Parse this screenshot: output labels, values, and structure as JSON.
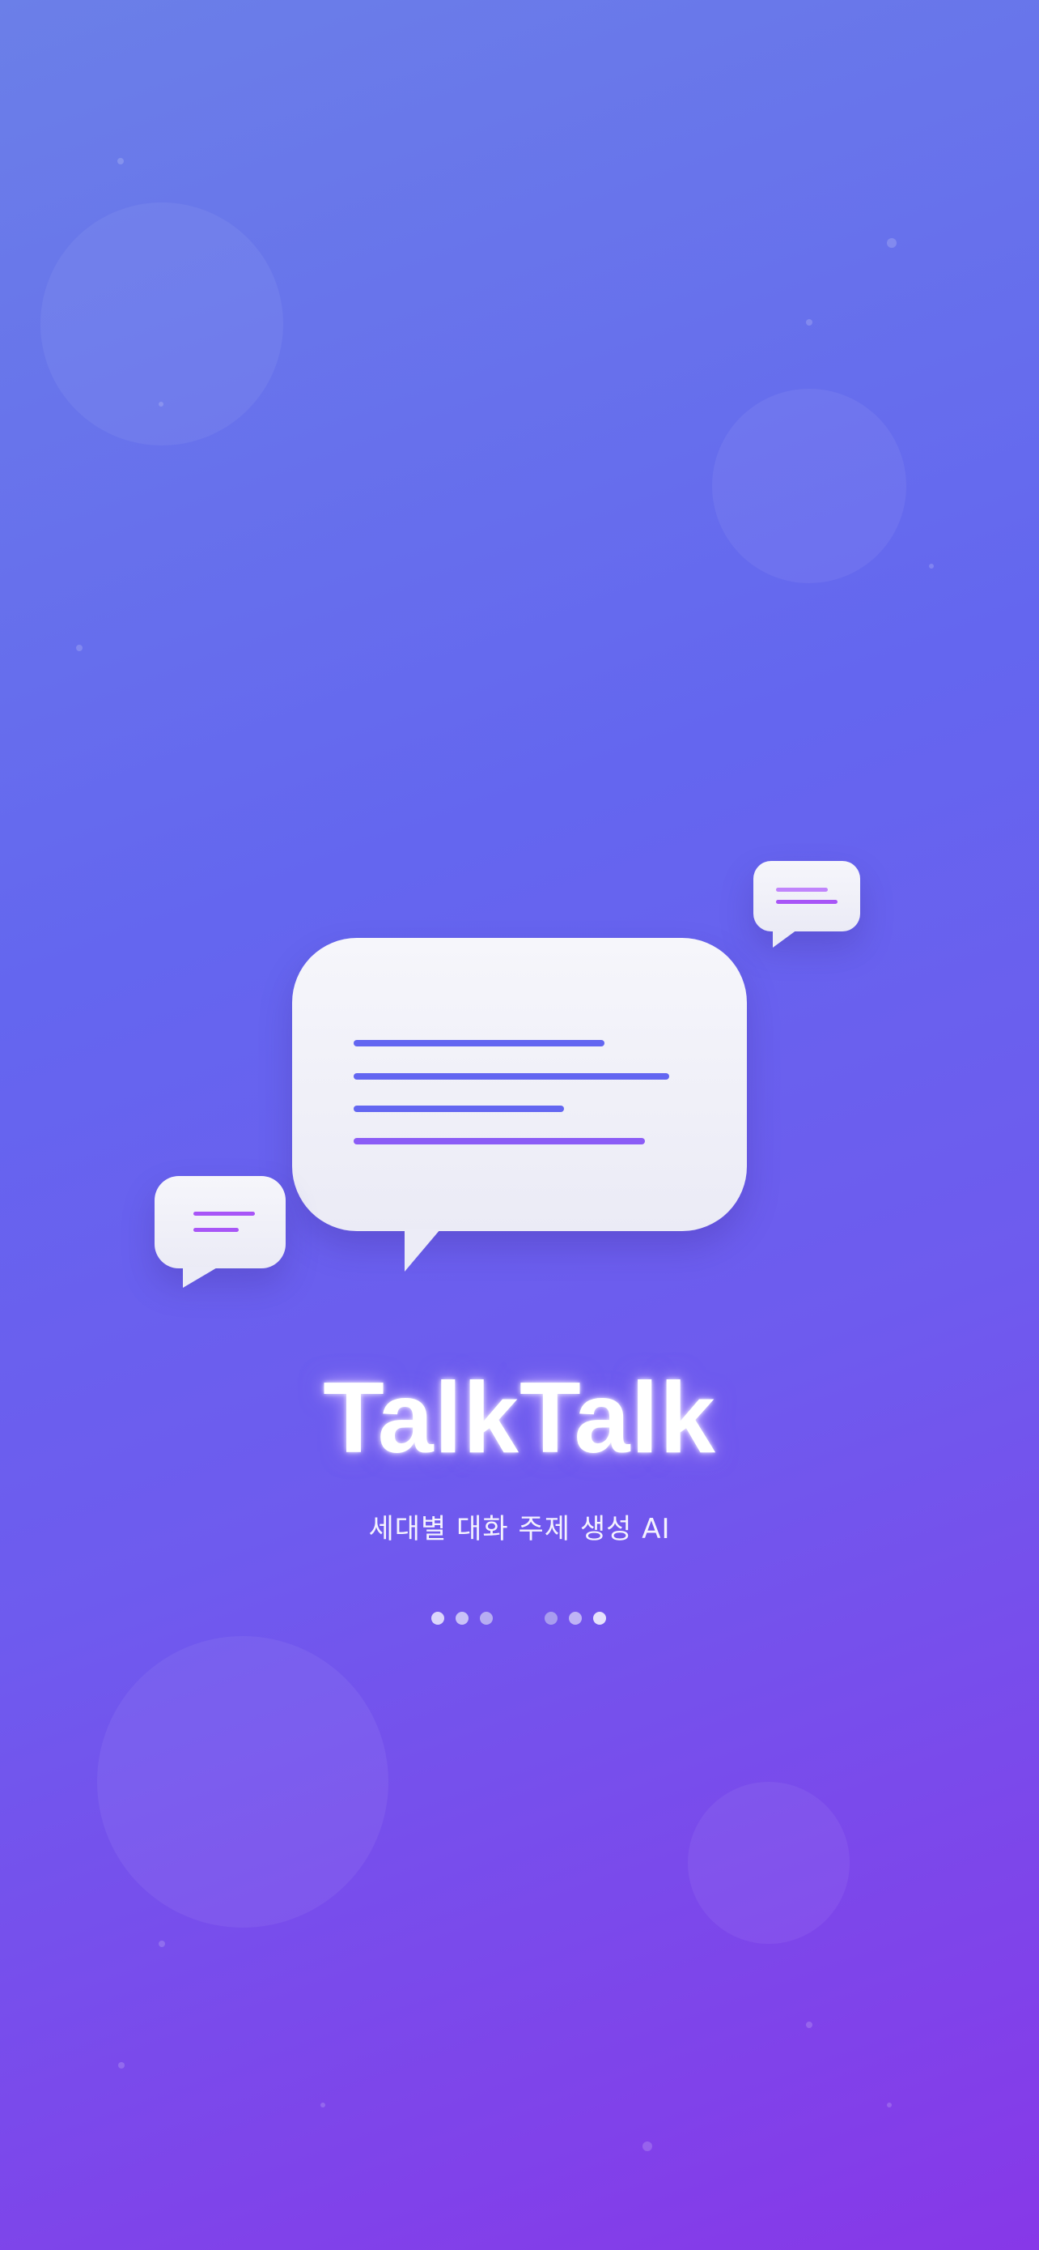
{
  "app": {
    "title": "TalkTalk",
    "tagline": "세대별 대화 주제 생성 AI"
  },
  "illustration": {
    "icon": "chat-bubbles-icon",
    "colors": {
      "line_primary": "#6366f1",
      "line_accent": "#8b5cf6",
      "line_small": "#a855f7",
      "bubble": "#f3f3fa"
    }
  },
  "loading_indicator": {
    "dot_count": 6,
    "colors": [
      "#dcd6fb",
      "#c9c1f7",
      "#b7adf2",
      "#a89cef",
      "#bfb3f5",
      "#e6e1fc"
    ]
  },
  "theme": {
    "gradient_start": "#6b7fe8",
    "gradient_mid": "#6466ef",
    "gradient_end": "#8738e8"
  }
}
